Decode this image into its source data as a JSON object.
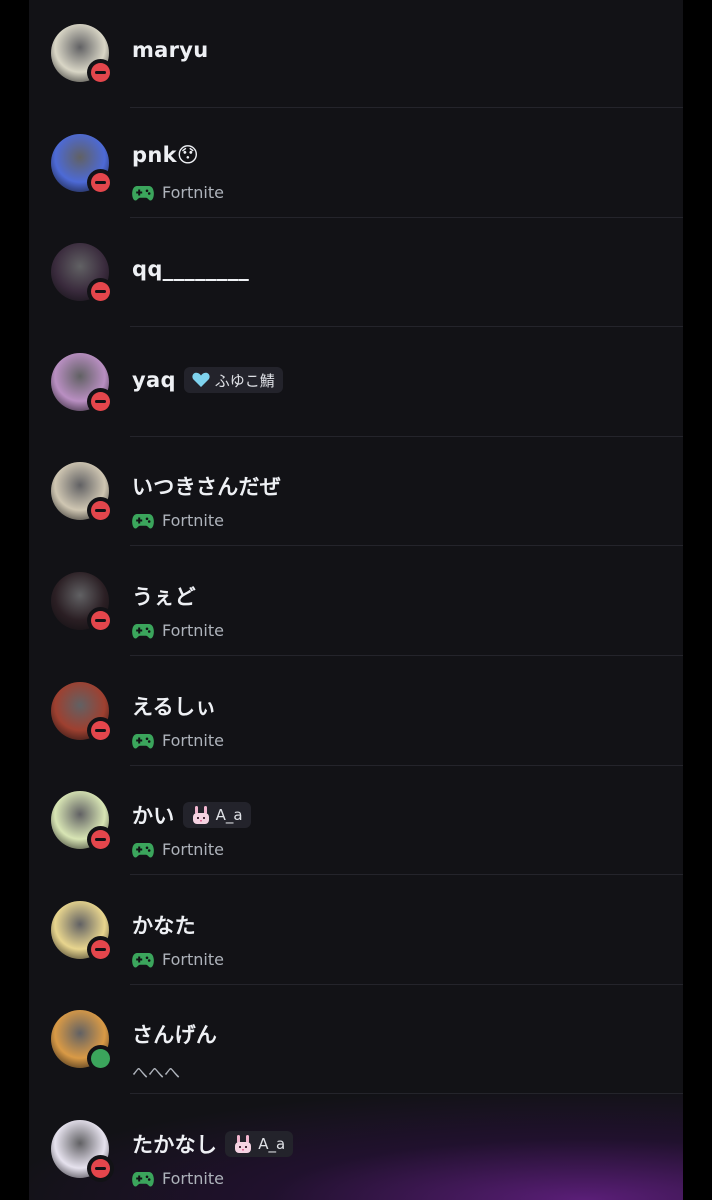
{
  "members": [
    {
      "name": "maryu",
      "badge": null,
      "activity": null,
      "status": "dnd",
      "avatar_color": "#d9d6c6"
    },
    {
      "name": "pnk😯",
      "badge": null,
      "activity": {
        "icon": "gamepad-icon",
        "text": "Fortnite"
      },
      "status": "dnd",
      "avatar_color": "#4d6ad6"
    },
    {
      "name": "qq________",
      "badge": null,
      "activity": null,
      "status": "dnd",
      "avatar_color": "#3a2b3d"
    },
    {
      "name": "yaq",
      "badge": {
        "icon": "heart-icon",
        "text": "ふゆこ鯖"
      },
      "activity": null,
      "status": "dnd",
      "avatar_color": "#b98fc2"
    },
    {
      "name": "いつきさんだぜ",
      "badge": null,
      "activity": {
        "icon": "gamepad-icon",
        "text": "Fortnite"
      },
      "status": "dnd",
      "avatar_color": "#cfc6b2"
    },
    {
      "name": "うぇど",
      "badge": null,
      "activity": {
        "icon": "gamepad-icon",
        "text": "Fortnite"
      },
      "status": "dnd",
      "avatar_color": "#2b1f24"
    },
    {
      "name": "えるしぃ",
      "badge": null,
      "activity": {
        "icon": "gamepad-icon",
        "text": "Fortnite"
      },
      "status": "dnd",
      "avatar_color": "#9e4030"
    },
    {
      "name": "かい",
      "badge": {
        "icon": "bunny-icon",
        "text": "A_a"
      },
      "activity": {
        "icon": "gamepad-icon",
        "text": "Fortnite"
      },
      "status": "dnd",
      "avatar_color": "#d8e5b4"
    },
    {
      "name": "かなた",
      "badge": null,
      "activity": {
        "icon": "gamepad-icon",
        "text": "Fortnite"
      },
      "status": "dnd",
      "avatar_color": "#e8d58e"
    },
    {
      "name": "さんげん",
      "badge": null,
      "activity": {
        "icon": null,
        "text": "へへへ"
      },
      "status": "online",
      "avatar_color": "#d99a46"
    },
    {
      "name": "たかなし",
      "badge": {
        "icon": "bunny-icon",
        "text": "A_a"
      },
      "activity": {
        "icon": "gamepad-icon",
        "text": "Fortnite"
      },
      "status": "dnd",
      "avatar_color": "#e6e2ee"
    }
  ],
  "colors": {
    "dnd": "#e4464c",
    "online": "#3ba55c",
    "game": "#3ba55c",
    "background": "#121216"
  }
}
